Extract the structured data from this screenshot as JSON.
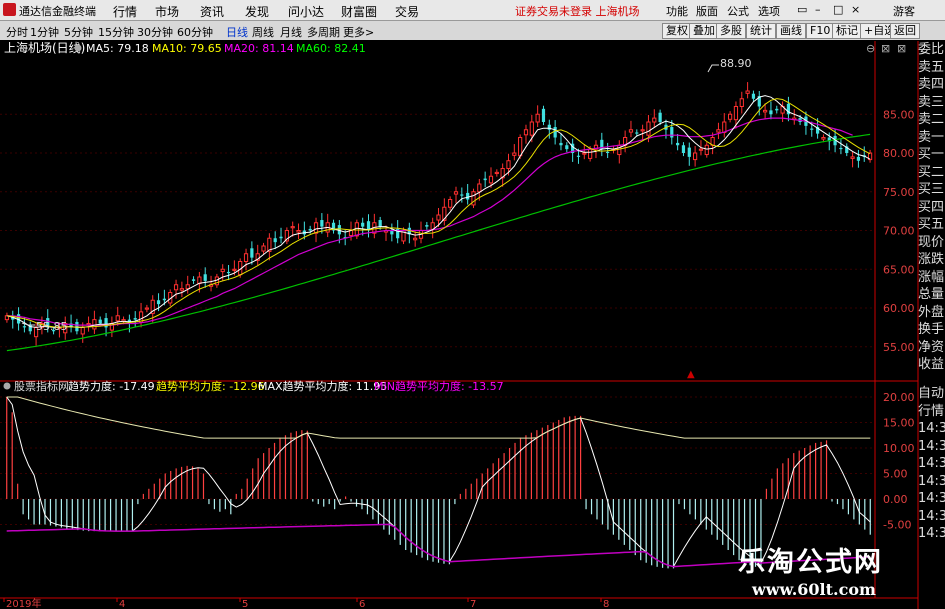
{
  "app": {
    "title": "通达信金融终端"
  },
  "menu": [
    "行情",
    "市场",
    "资讯",
    "发现",
    "问小达",
    "财富圈",
    "交易"
  ],
  "status": "证券交易未登录  上海机场",
  "right_menu": [
    "功能",
    "版面",
    "公式",
    "选项"
  ],
  "guest": "游客",
  "periods": [
    "分时",
    "1分钟",
    "5分钟",
    "15分钟",
    "30分钟",
    "60分钟",
    "日线",
    "周线",
    "月线",
    "多周期",
    "更多>"
  ],
  "active_period": "日线",
  "tools": [
    "复权",
    "叠加",
    "多股",
    "统计",
    "画线",
    "F10",
    "标记",
    "+自选",
    "返回"
  ],
  "main_chart": {
    "title": "上海机场(日线)",
    "ma": [
      {
        "label": "MA5: 79.18",
        "color": "#ffffff"
      },
      {
        "label": "MA10: 79.65",
        "color": "#ffff00"
      },
      {
        "label": "MA20: 81.14",
        "color": "#ff00ff"
      },
      {
        "label": "MA60: 82.41",
        "color": "#00ff00"
      }
    ],
    "high_label": "88.90",
    "low_label": "55.85",
    "y_ticks": [
      "85.00",
      "80.00",
      "75.00",
      "70.00",
      "65.00",
      "60.00",
      "55.00"
    ]
  },
  "indicator": {
    "name": "股票指标网",
    "items": [
      {
        "label": "趋势力度: -17.49",
        "color": "#ffffff"
      },
      {
        "label": "趋势平均力度: -12.96",
        "color": "#ffff00"
      },
      {
        "label": "MAX趋势平均力度: 11.95",
        "color": "#ffffff"
      },
      {
        "label": "MIN趋势平均力度: -13.57",
        "color": "#ff00ff"
      }
    ],
    "y_ticks": [
      "20.00",
      "15.00",
      "10.00",
      "5.00",
      "0.00",
      "-5.00"
    ]
  },
  "x_ticks": [
    "2019年",
    "4",
    "5",
    "6",
    "7",
    "8"
  ],
  "side_labels": [
    "委比",
    "卖五",
    "卖四",
    "卖三",
    "卖二",
    "卖一",
    "买一",
    "买二",
    "买三",
    "买四",
    "买五",
    "现价",
    "涨跌",
    "涨幅",
    "总量",
    "外盘",
    "换手",
    "净资",
    "收益"
  ],
  "side2_labels": [
    "自动",
    "行情",
    "14:30",
    "14:30",
    "14:30",
    "14:30",
    "14:30",
    "14:30",
    "14:30"
  ],
  "watermark": {
    "line1": "乐淘公式网",
    "line2": "www.60lt.com"
  },
  "chart_data": {
    "type": "candlestick",
    "y_range": [
      52,
      92
    ],
    "closes": [
      59,
      58.5,
      58,
      57.5,
      57,
      57.5,
      58,
      57.5,
      57,
      57.5,
      58,
      57.5,
      57,
      57.5,
      58,
      58.5,
      58,
      57.5,
      58,
      59,
      58.5,
      58,
      58.5,
      59.5,
      60,
      61,
      60.5,
      61,
      62,
      63,
      62.5,
      63,
      63.5,
      64,
      63.5,
      63,
      64,
      65,
      64.5,
      65,
      66,
      67,
      66.5,
      67,
      68,
      69,
      68.5,
      69,
      70,
      70.5,
      70,
      69.5,
      70,
      71,
      70.5,
      71,
      70,
      69.5,
      69,
      70,
      71,
      70.5,
      70,
      71,
      70.5,
      70,
      69.5,
      69,
      70,
      69.5,
      69,
      70,
      70.5,
      71,
      72,
      73,
      74,
      75,
      74.5,
      74,
      75,
      76,
      76.5,
      77,
      77.5,
      78,
      79,
      80,
      82,
      83,
      84,
      85,
      84,
      83,
      82,
      81,
      80.5,
      80,
      79.5,
      80,
      80.5,
      81,
      80.5,
      80,
      80.5,
      81,
      82,
      83,
      82.5,
      83,
      84,
      84.5,
      84,
      83,
      82,
      81,
      80,
      79.5,
      80,
      80.5,
      81,
      82,
      83,
      84,
      85,
      86,
      87,
      88,
      87,
      86,
      85.5,
      85,
      85.5,
      86,
      85,
      84.5,
      84,
      83.5,
      83,
      82.5,
      82,
      81.5,
      81,
      80.5,
      80,
      79.5,
      79,
      79.5,
      80
    ],
    "ma5": [
      59,
      58.8,
      58.5,
      58.1,
      57.6,
      57.5,
      57.6,
      57.6,
      57.5,
      57.5,
      57.6,
      57.6,
      57.5,
      57.5,
      57.6,
      57.8,
      57.9,
      57.9,
      58,
      58.2,
      58.3,
      58.2,
      58.3,
      58.6,
      59,
      59.6,
      60,
      60.6,
      61.2,
      61.8,
      62,
      62.4,
      62.8,
      63.2,
      63.3,
      63.4,
      63.6,
      64,
      64.2,
      64.5,
      65,
      65.6,
      65.9,
      66.3,
      66.9,
      67.5,
      67.7,
      68.1,
      68.9,
      69.4,
      69.6,
      69.7,
      69.8,
      70.2,
      70.3,
      70.4,
      70.2,
      70,
      69.8,
      70,
      70.3,
      70.2,
      70.1,
      70.4,
      70.5,
      70.5,
      70.2,
      69.9,
      69.8,
      69.6,
      69.4,
      69.5,
      69.8,
      70.1,
      70.7,
      71.5,
      72.4,
      73.4,
      74.1,
      74.3,
      74.5,
      74.9,
      75.4,
      75.8,
      76.3,
      76.9,
      77.5,
      78.3,
      79.6,
      80.8,
      81.9,
      83,
      83.2,
      83.2,
      83,
      82.5,
      81.7,
      80.8,
      80.3,
      80.1,
      80.1,
      80.2,
      80.5,
      80.6,
      80.5,
      80.7,
      81,
      81.5,
      82.2,
      82.5,
      82.8,
      83.3,
      83.8,
      84.1,
      83.9,
      83.5,
      82.9,
      82,
      81.3,
      80.7,
      80.5,
      80.6,
      81,
      81.7,
      82.6,
      83.6,
      84.6,
      85.6,
      86.6,
      87.2,
      87.4,
      87.2,
      86.7,
      86,
      85.3,
      85,
      84.7,
      84.2,
      83.7,
      83.2,
      82.7,
      82.2,
      81.7,
      81.2,
      80.7,
      80.2,
      79.8,
      79.6,
      79.2
    ],
    "ma20": [
      59,
      59,
      58.9,
      58.8,
      58.6,
      58.5,
      58.4,
      58.3,
      58.1,
      58,
      57.9,
      57.9,
      57.8,
      57.8,
      57.8,
      57.8,
      57.8,
      57.8,
      57.8,
      57.9,
      58,
      58,
      58,
      58.1,
      58.2,
      58.4,
      58.6,
      58.8,
      59.1,
      59.4,
      59.7,
      60,
      60.3,
      60.6,
      60.9,
      61.2,
      61.5,
      61.9,
      62.2,
      62.5,
      62.9,
      63.3,
      63.7,
      64.1,
      64.5,
      64.9,
      65.3,
      65.7,
      66.1,
      66.5,
      66.9,
      67.2,
      67.5,
      67.8,
      68.1,
      68.4,
      68.6,
      68.8,
      69,
      69.2,
      69.4,
      69.6,
      69.7,
      69.8,
      69.9,
      70,
      70,
      70,
      70,
      70,
      70,
      70,
      70,
      70.1,
      70.2,
      70.4,
      70.6,
      70.9,
      71.2,
      71.5,
      71.8,
      72.2,
      72.6,
      73,
      73.5,
      74,
      74.6,
      75.2,
      75.9,
      76.6,
      77.3,
      78,
      78.6,
      79.1,
      79.5,
      79.8,
      80,
      80.2,
      80.3,
      80.4,
      80.5,
      80.6,
      80.7,
      80.8,
      80.9,
      81,
      81.1,
      81.3,
      81.5,
      81.7,
      81.9,
      82.1,
      82.2,
      82.3,
      82.3,
      82.3,
      82.2,
      82.1,
      82.1,
      82.1,
      82.2,
      82.3,
      82.5,
      82.7,
      83,
      83.3,
      83.6,
      83.9,
      84.1,
      84.3,
      84.4,
      84.5,
      84.5,
      84.5,
      84.4,
      84.3,
      84.2,
      84.1,
      83.9,
      83.7,
      83.5,
      83.3,
      83.1,
      82.9,
      82.6,
      82.3
    ],
    "ma60_start": 54.5,
    "ma60_end": 82.4,
    "indicator_values": [
      20,
      17,
      3,
      -3,
      -4,
      -5,
      -5,
      -5,
      -5.2,
      -5.4,
      -5.6,
      -5.8,
      -6,
      -6.1,
      -6.2,
      -6.3,
      -6.3,
      -6.3,
      -6.3,
      -6.3,
      -6.3,
      -6.3,
      -6.3,
      -6.3,
      -1,
      1,
      2,
      3,
      4,
      5,
      5.5,
      6,
      6.3,
      6.5,
      6.4,
      6,
      5,
      -1,
      -2,
      -2.5,
      -2,
      -3,
      1,
      2,
      4,
      6,
      8,
      9,
      10,
      11,
      12,
      12.5,
      13,
      13.3,
      13.5,
      13.4,
      -0.5,
      -1,
      -1.5,
      -1,
      -2,
      -0.5,
      0.5,
      -0.5,
      -1.5,
      -2,
      -3,
      -4,
      -5,
      -6,
      -7,
      -8,
      -9,
      -10,
      -10.5,
      -11,
      -11.5,
      -12,
      -12.3,
      -12.5,
      -12.7,
      -12.8,
      -1,
      1,
      2,
      3,
      4,
      5,
      6,
      7,
      8,
      9,
      10,
      11,
      12,
      12.5,
      13,
      13.5,
      14,
      14.5,
      15,
      15.5,
      16,
      16.2,
      16.3,
      16.3,
      -2,
      -3,
      -4,
      -5,
      -6,
      -7,
      -8,
      -9,
      -10,
      -11,
      -12,
      -12.5,
      -13,
      -13.3,
      -13.5,
      -13.6,
      -13.6,
      -1,
      -2,
      -3,
      -4,
      -5,
      -6,
      -7,
      -8,
      -9,
      -10,
      -11,
      -12,
      -12.5,
      -13,
      -13.3,
      -13.5,
      2,
      4,
      6,
      7,
      8,
      9,
      9.5,
      10,
      10.5,
      11,
      11.2,
      11.5,
      -0.5,
      -1,
      -2,
      -3,
      -4,
      -5,
      -6,
      -7
    ]
  }
}
